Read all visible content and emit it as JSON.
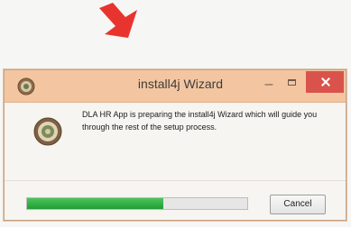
{
  "dialog": {
    "title": "install4j Wizard",
    "message": "DLA HR App is preparing the install4j Wizard which will guide you through the rest of the setup process.",
    "progress_value": 0.62,
    "cancel_label": "Cancel"
  },
  "icons": {
    "annotation_arrow": "red-arrow-icon",
    "title_icon": "app-seal-icon",
    "message_icon": "dla-seal-icon",
    "minimize": "minimize-icon",
    "maximize": "maximize-icon",
    "close": "close-icon"
  },
  "colors": {
    "title_bar": "#f3c6a1",
    "close_button": "#d9534c",
    "progress_fill": "#2faa43",
    "annotation_arrow": "#e8342f"
  }
}
